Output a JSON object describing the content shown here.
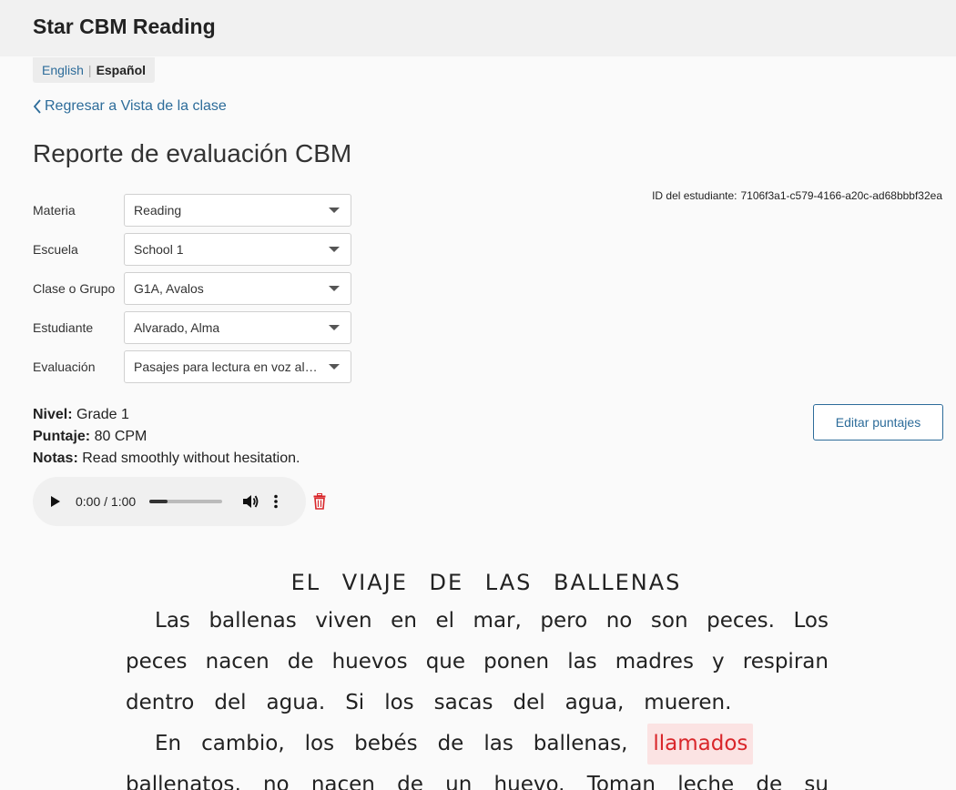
{
  "app": {
    "title": "Star CBM Reading"
  },
  "language": {
    "english": "English",
    "separator": "|",
    "spanish": "Español"
  },
  "nav": {
    "back_label": "Regresar a Vista de la clase"
  },
  "page": {
    "title": "Reporte de evaluación CBM"
  },
  "student_id": {
    "label": "ID del estudiante:",
    "value": "7106f3a1-c579-4166-a20c-ad68bbbf32ea"
  },
  "filters": [
    {
      "label": "Materia",
      "value": "Reading"
    },
    {
      "label": "Escuela",
      "value": "School 1"
    },
    {
      "label": "Clase o Grupo",
      "value": "G1A, Avalos"
    },
    {
      "label": "Estudiante",
      "value": "Alvarado, Alma"
    },
    {
      "label": "Evaluación",
      "value": "Pasajes para lectura en voz alta 1"
    }
  ],
  "result": {
    "level_label": "Nivel:",
    "level_value": "Grade 1",
    "score_label": "Puntaje:",
    "score_value": "80 CPM",
    "notes_label": "Notas:",
    "notes_value": "Read smoothly without hesitation."
  },
  "edit_button": {
    "label": "Editar puntajes"
  },
  "audio": {
    "time": "0:00 / 1:00",
    "progress_fraction": 0.25
  },
  "passage": {
    "title": "EL VIAJE DE LAS BALLENAS",
    "lines": [
      {
        "words": [
          "Las",
          "ballenas",
          "viven",
          "en",
          "el",
          "mar,",
          "pero",
          "no",
          "son",
          "peces.",
          "Los"
        ]
      },
      {
        "words": [
          "peces",
          "nacen",
          "de",
          "huevos",
          "que",
          "ponen",
          "las",
          "madres",
          "y",
          "respiran"
        ]
      },
      {
        "words": [
          "dentro",
          "del",
          "agua.",
          "Si",
          "los",
          "sacas",
          "del",
          "agua,",
          "mueren."
        ]
      },
      {
        "words": [
          "En",
          "cambio,",
          "los",
          "bebés",
          "de",
          "las",
          "ballenas,"
        ],
        "highlighted": "llamados"
      },
      {
        "words": [
          "ballenatos,",
          "no",
          "nacen",
          "de",
          "un",
          "huevo.",
          "Toman",
          "leche",
          "de",
          "su"
        ]
      }
    ]
  },
  "colors": {
    "link": "#2d6c9a",
    "error_text": "#d9262a",
    "error_bg": "#fbe3e3"
  }
}
